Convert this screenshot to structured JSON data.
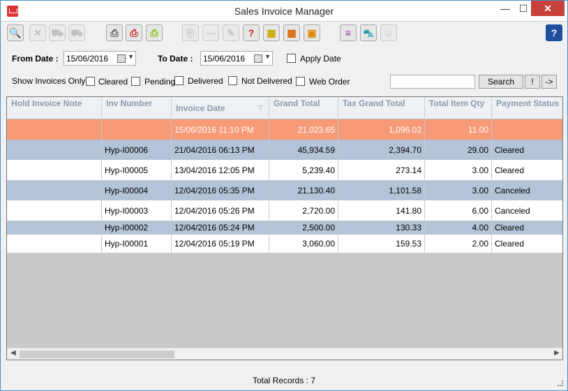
{
  "window": {
    "title": "Sales Invoice Manager",
    "min": "—",
    "max": "☐",
    "close": "✕"
  },
  "toolbar": {
    "buttons": [
      {
        "name": "search-icon",
        "glyph": "🔍",
        "color": "#f0a020"
      },
      {
        "name": "delete-icon",
        "glyph": "✕",
        "color": "#999999"
      },
      {
        "name": "truck-icon",
        "glyph": "⛟",
        "color": "#999999"
      },
      {
        "name": "delivery-icon",
        "glyph": "⛟",
        "color": "#999999"
      },
      {
        "name": "print-icon",
        "glyph": "⎙",
        "color": "#555555"
      },
      {
        "name": "print-red-icon",
        "glyph": "⎙",
        "color": "#cc2222"
      },
      {
        "name": "print-green-icon",
        "glyph": "⎙",
        "color": "#88bb00"
      },
      {
        "name": "copy-icon",
        "glyph": "⎘",
        "color": "#aaaaaa"
      },
      {
        "name": "minus-icon",
        "glyph": "—",
        "color": "#aaaaaa"
      },
      {
        "name": "eraser-icon",
        "glyph": "✎",
        "color": "#aaaaaa"
      },
      {
        "name": "help-doc-icon",
        "glyph": "?",
        "color": "#cc2222"
      },
      {
        "name": "grid-down-icon",
        "glyph": "▦",
        "color": "#ccaa00"
      },
      {
        "name": "grid-arrow-icon",
        "glyph": "▦",
        "color": "#dd6600"
      },
      {
        "name": "box-icon",
        "glyph": "▣",
        "color": "#dd8800"
      },
      {
        "name": "list-icon",
        "glyph": "≡",
        "color": "#993399"
      },
      {
        "name": "cart-icon",
        "glyph": "⛍",
        "color": "#2299aa"
      },
      {
        "name": "users-icon",
        "glyph": "☺",
        "color": "#aaaaaa"
      },
      {
        "name": "help-icon",
        "glyph": "?",
        "color": "#ffffff"
      }
    ]
  },
  "filters": {
    "from_label": "From Date :",
    "from_value": "15/06/2016",
    "to_label": "To Date :",
    "to_value": "15/06/2016",
    "apply_date": "Apply Date",
    "show_label": "Show Invoices Only :",
    "options": [
      "Cleared",
      "Pending",
      "Delivered",
      "Not Delivered",
      "Web Order"
    ]
  },
  "search": {
    "value": "",
    "button": "Search",
    "bang": "!",
    "arrow": "->"
  },
  "table": {
    "columns": [
      "Hold Invoice Note",
      "Inv Number",
      "Invoice Date",
      "Grand Total",
      "Tax Grand Total",
      "Total Item Qty",
      "Payment Status"
    ],
    "sort_indicator": "▽",
    "rows": [
      {
        "note": "",
        "inv": "",
        "date": "15/06/2016 11:10 PM",
        "grand": "21,023.65",
        "tax": "1,096.02",
        "qty": "11.00",
        "status": ""
      },
      {
        "note": "",
        "inv": "Hyp-I00006",
        "date": "21/04/2016 06:13 PM",
        "grand": "45,934.59",
        "tax": "2,394.70",
        "qty": "29.00",
        "status": "Cleared"
      },
      {
        "note": "",
        "inv": "Hyp-I00005",
        "date": "13/04/2016 12:05 PM",
        "grand": "5,239.40",
        "tax": "273.14",
        "qty": "3.00",
        "status": "Cleared"
      },
      {
        "note": "",
        "inv": "Hyp-I00004",
        "date": "12/04/2016 05:35 PM",
        "grand": "21,130.40",
        "tax": "1,101.58",
        "qty": "3.00",
        "status": "Canceled"
      },
      {
        "note": "",
        "inv": "Hyp-I00003",
        "date": "12/04/2016 05:26 PM",
        "grand": "2,720.00",
        "tax": "141.80",
        "qty": "6.00",
        "status": "Canceled"
      },
      {
        "note": "",
        "inv": "Hyp-I00002",
        "date": "12/04/2016 05:24 PM",
        "grand": "2,500.00",
        "tax": "130.33",
        "qty": "4.00",
        "status": "Cleared"
      },
      {
        "note": "",
        "inv": "Hyp-I00001",
        "date": "12/04/2016 05:19 PM",
        "grand": "3,060.00",
        "tax": "159.53",
        "qty": "2.00",
        "status": "Cleared"
      }
    ]
  },
  "colors": {
    "selected_row": "#f79a77",
    "alt_row": "#b4c4d8",
    "row": "#ffffff",
    "empty_area": "#c9c9c9"
  },
  "status": {
    "text": "Total Records : 7"
  }
}
